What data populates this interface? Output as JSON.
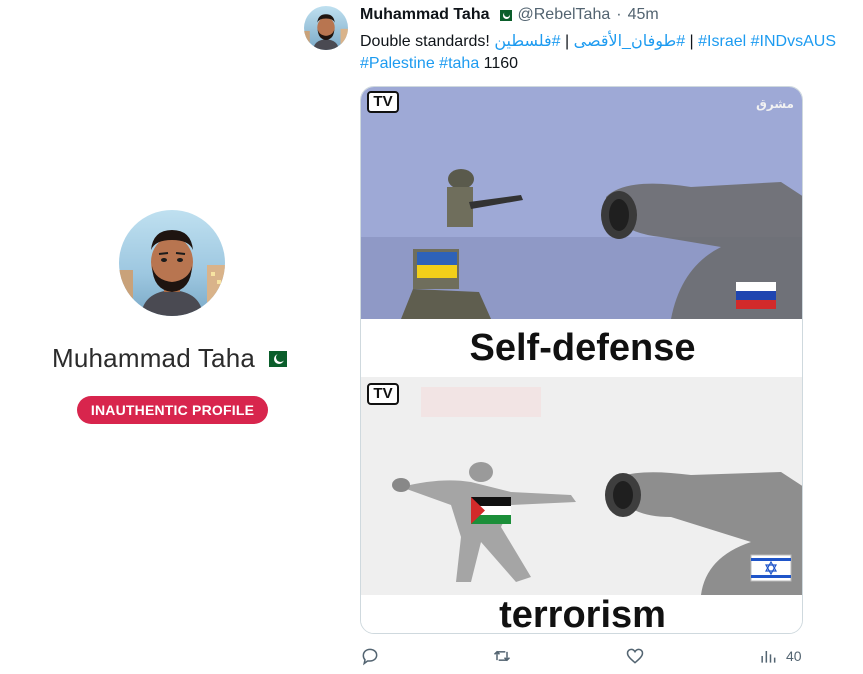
{
  "profile": {
    "display_name": "Muhammad Taha",
    "flag_icon": "pakistan-flag-icon",
    "badge_label": "INAUTHENTIC PROFILE",
    "badge_color": "#d8254d"
  },
  "tweet": {
    "author_name": "Muhammad Taha",
    "handle": "@RebelTaha",
    "separator": "·",
    "time": "45m",
    "text_prefix": "Double standards! ",
    "hashtag_arabic_1": "#فلسطين",
    "sep_1": " | ",
    "hashtag_arabic_2": "#طوفان_الأقصى",
    "sep_2": " | ",
    "hashtag_israel": "#Israel",
    "hashtag_indvsaus": "#INDvsAUS",
    "hashtag_palestine": "#Palestine",
    "hashtag_taha": "#taha",
    "text_suffix": " 1160",
    "hashtag_color": "#1d9bf0"
  },
  "media": {
    "tv_logo_label": "TV",
    "watermark": "مشرق",
    "top_caption": "Self-defense",
    "bottom_caption": "terrorism"
  },
  "actions": {
    "reply_icon": "reply-icon",
    "retweet_icon": "retweet-icon",
    "like_icon": "heart-icon",
    "views_icon": "views-icon",
    "views_count": "40"
  }
}
